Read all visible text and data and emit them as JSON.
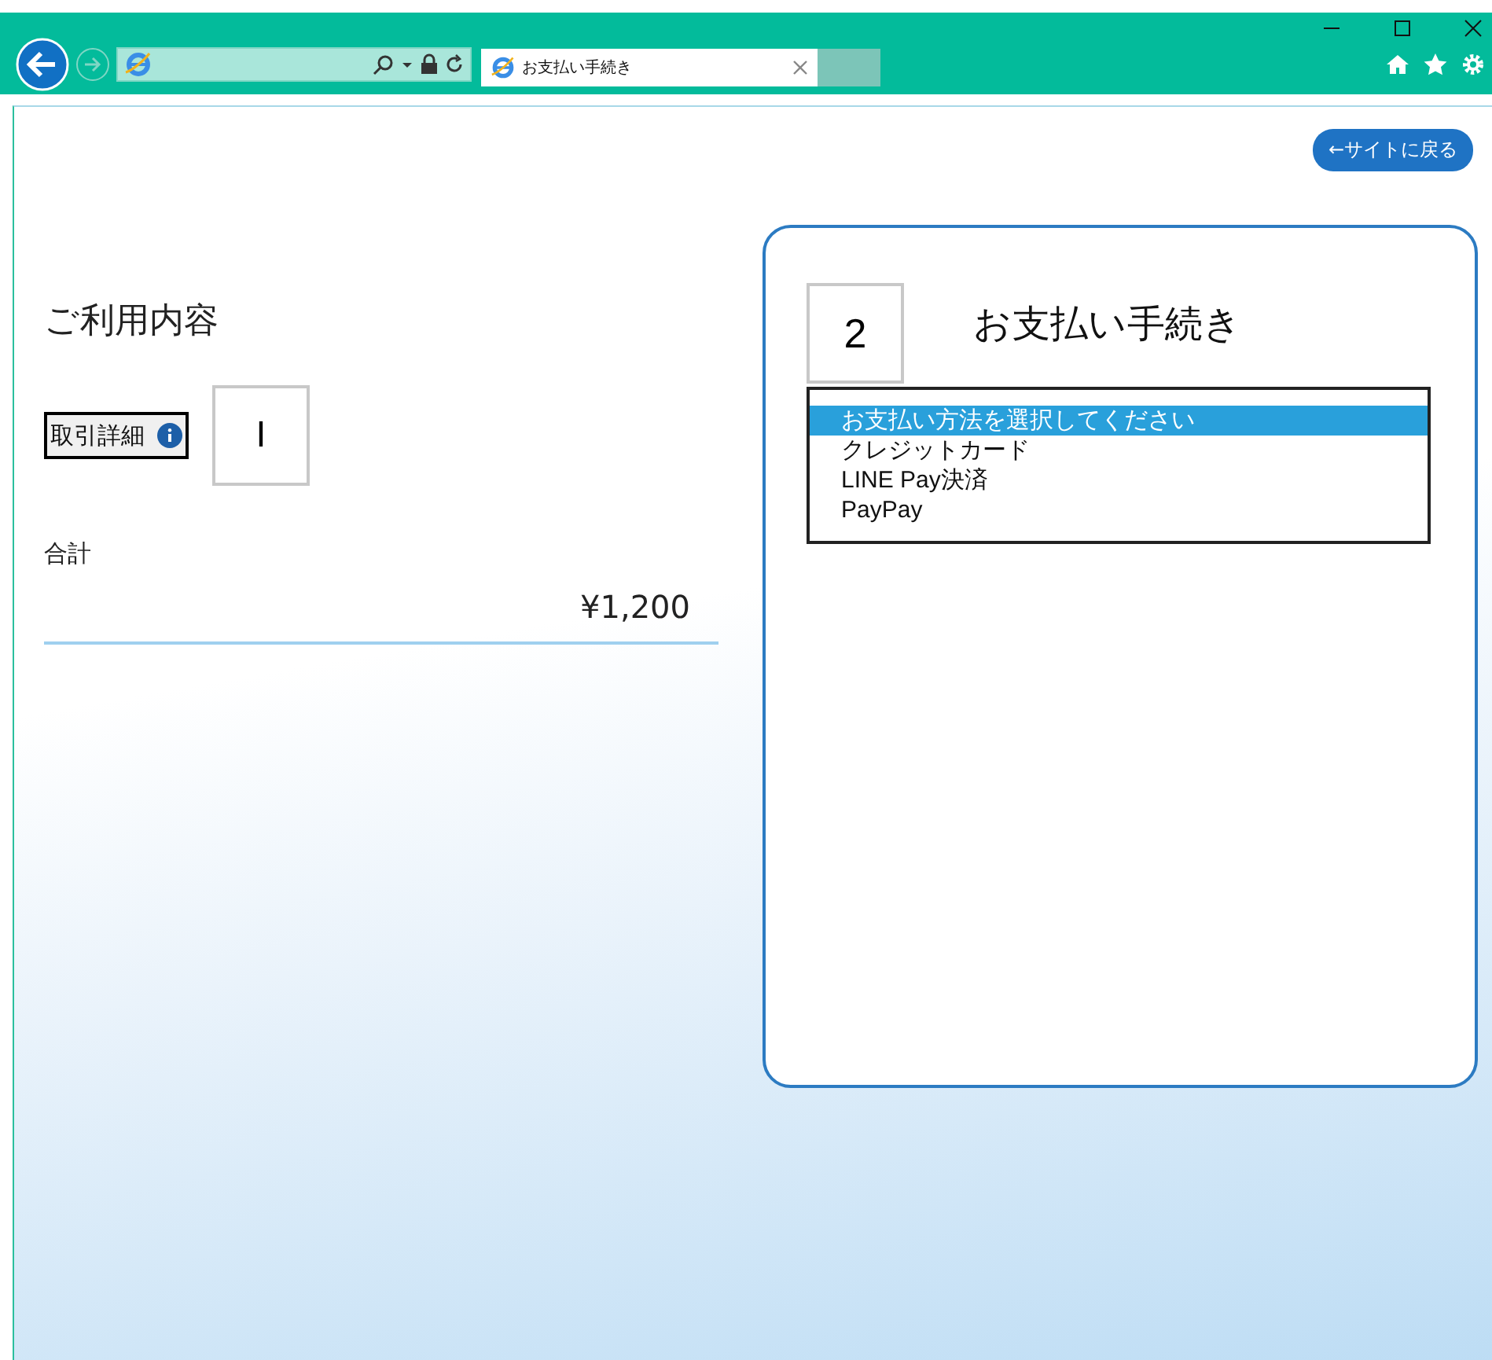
{
  "browser": {
    "tab_title": "お支払い手続き"
  },
  "back_button": "←サイトに戻る",
  "usage": {
    "title": "ご利用内容",
    "details_button": "取引詳細",
    "step_box": "I",
    "total_label": "合計",
    "total_value": "¥1,200"
  },
  "payment": {
    "step_box": "2",
    "title": "お支払い手続き",
    "options": [
      {
        "label": "お支払い方法を選択してください",
        "selected": true
      },
      {
        "label": "クレジットカード",
        "selected": false
      },
      {
        "label": "LINE Pay決済",
        "selected": false
      },
      {
        "label": "PayPay",
        "selected": false
      }
    ]
  }
}
